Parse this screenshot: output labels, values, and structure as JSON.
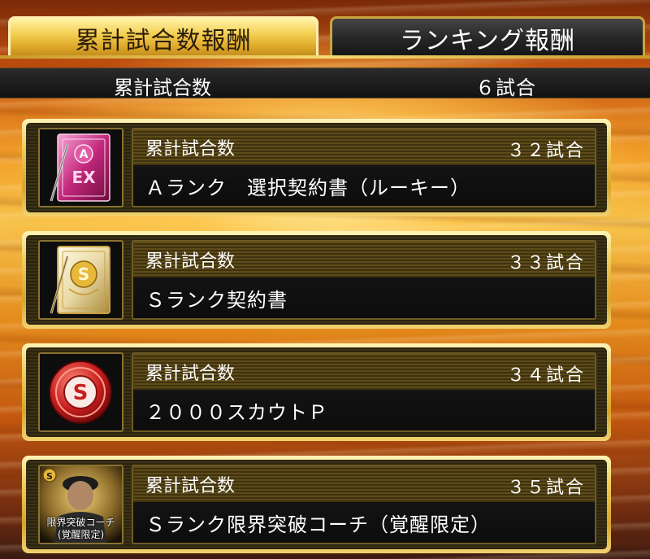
{
  "tabs": {
    "cumulative_label": "累計試合数報酬",
    "ranking_label": "ランキング報酬"
  },
  "summary": {
    "label": "累計試合数",
    "value": "６試合"
  },
  "rewards": [
    {
      "category": "累計試合数",
      "count": "３２試合",
      "name": "Ａランク　選択契約書（ルーキー）",
      "icon": "pink-contract-book-icon"
    },
    {
      "category": "累計試合数",
      "count": "３３試合",
      "name": "Ｓランク契約書",
      "icon": "gold-contract-book-icon"
    },
    {
      "category": "累計試合数",
      "count": "３４試合",
      "name": "２０００スカウトＰ",
      "icon": "scout-point-coin-icon"
    },
    {
      "category": "累計試合数",
      "count": "３５試合",
      "name": "Ｓランク限界突破コーチ（覚醒限定）",
      "icon": "limit-break-coach-icon",
      "icon_label_line1": "限界突破コーチ",
      "icon_label_line2": "(覚醒限定)"
    }
  ],
  "colors": {
    "gold": "#f1cb56",
    "active_tab": "#f4cf52",
    "dark_panel": "#111111",
    "coin_red": "#c81e1e"
  }
}
